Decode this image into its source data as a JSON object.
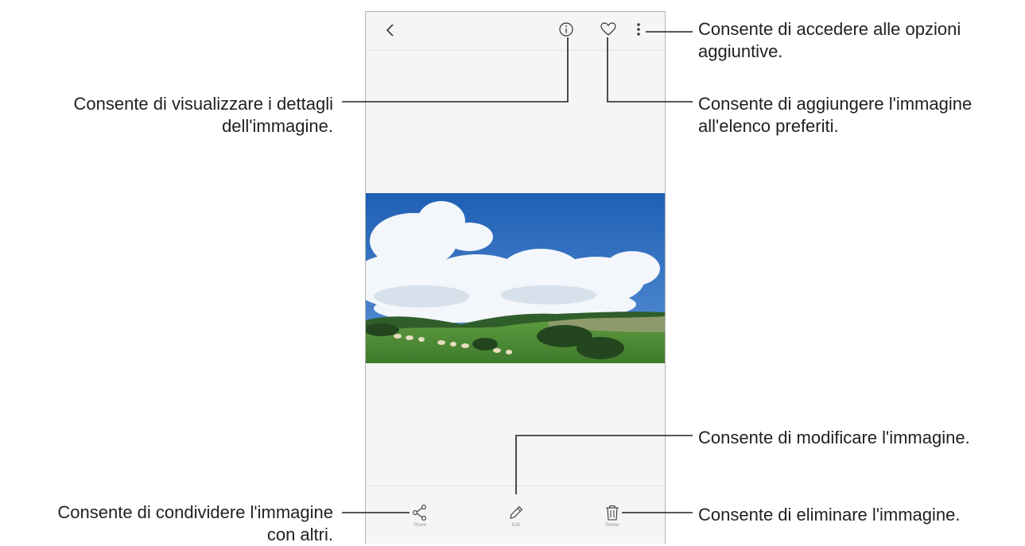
{
  "toolbar": {
    "back_icon": "chevron-left-icon",
    "details_icon": "info-icon",
    "favorite_icon": "heart-icon",
    "more_icon": "more-vertical-icon"
  },
  "bottom_toolbar": {
    "share_label": "Share",
    "edit_label": "Edit",
    "delete_label": "Delete"
  },
  "callouts": {
    "more_options": [
      "Consente di accedere alle opzioni",
      "aggiuntive."
    ],
    "details": [
      "Consente di visualizzare i dettagli",
      "dell'immagine."
    ],
    "favorites": [
      "Consente di aggiungere l'immagine",
      "all'elenco preferiti."
    ],
    "edit": [
      "Consente di modificare l'immagine."
    ],
    "share": [
      "Consente di condividere l'immagine",
      "con altri."
    ],
    "delete": [
      "Consente di eliminare l'immagine."
    ]
  },
  "colors": {
    "screen_bg": "#f4f5f4",
    "callout_line": "#231f20",
    "sky": "#2f6fc0",
    "grass": "#4f8f3a"
  }
}
